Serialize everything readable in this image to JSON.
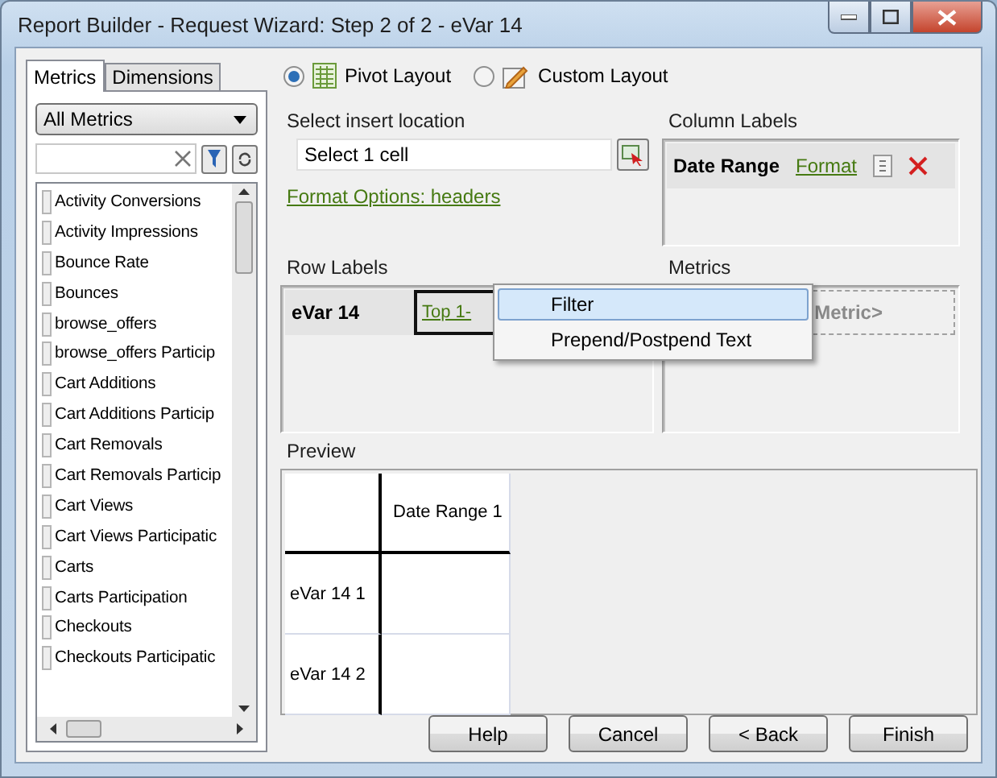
{
  "window": {
    "title": "Report Builder - Request Wizard: Step 2 of 2 - eVar 14"
  },
  "sidebar": {
    "tabs": [
      {
        "label": "Metrics",
        "selected": true
      },
      {
        "label": "Dimensions",
        "selected": false
      }
    ],
    "dropdown": {
      "value": "All Metrics"
    },
    "items": [
      "Activity Conversions",
      "Activity Impressions",
      "Bounce Rate",
      "Bounces",
      "browse_offers",
      "browse_offers Particip",
      "Cart Additions",
      "Cart Additions Particip",
      "Cart Removals",
      "Cart Removals Particip",
      "Cart Views",
      "Cart Views Participatic",
      "Carts",
      "Carts Participation",
      "Checkouts",
      "Checkouts Participatic"
    ]
  },
  "layout_options": [
    {
      "label": "Pivot Layout",
      "selected": true
    },
    {
      "label": "Custom Layout",
      "selected": false
    }
  ],
  "insert_location": {
    "label": "Select insert location",
    "value": "Select 1 cell",
    "link": "Format Options: headers"
  },
  "column_labels": {
    "heading": "Column Labels",
    "name": "Date Range",
    "link": "Format"
  },
  "row_labels": {
    "heading": "Row Labels",
    "name": "eVar 14",
    "link": "Top 1-"
  },
  "metrics": {
    "heading": "Metrics",
    "placeholder": "Metric>"
  },
  "context_menu": [
    {
      "label": "Filter",
      "selected": true
    },
    {
      "label": "Prepend/Postpend Text",
      "selected": false
    }
  ],
  "preview": {
    "heading": "Preview",
    "columns": [
      "Date Range 1"
    ],
    "rows": [
      "eVar 14 1",
      "eVar 14 2"
    ]
  },
  "buttons": [
    "Help",
    "Cancel",
    "< Back",
    "Finish"
  ]
}
